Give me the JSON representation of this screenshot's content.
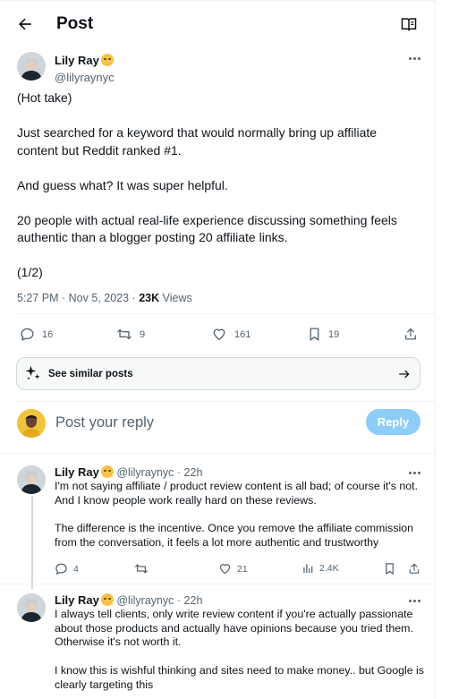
{
  "header": {
    "title": "Post"
  },
  "post": {
    "author_name": "Lily Ray",
    "author_handle": "@lilyraynyc",
    "paragraphs": [
      "(Hot take)",
      "Just searched for a keyword that would normally bring up affiliate content but Reddit ranked #1.",
      "And guess what? It was super helpful.",
      "20 people with actual real-life experience discussing something feels authentic than a blogger posting 20 affiliate links.",
      "(1/2)"
    ],
    "timestamp": "5:27 PM · Nov 5, 2023",
    "views_count": "23K",
    "views_label": "Views",
    "stats": {
      "replies": "16",
      "reposts": "9",
      "likes": "161",
      "bookmarks": "19"
    }
  },
  "similar_posts": {
    "label": "See similar posts"
  },
  "composer": {
    "placeholder": "Post your reply",
    "button_label": "Reply"
  },
  "replies": [
    {
      "author_name": "Lily Ray",
      "author_handle": "@lilyraynyc",
      "time": "· 22h",
      "paragraphs": [
        "I'm not saying affiliate / product review content is all bad; of course it's not. And I know people work really hard on these reviews.",
        "The difference is the incentive. Once you remove the affiliate commission from the conversation, it feels a lot more authentic and trustworthy"
      ],
      "stats": {
        "replies": "4",
        "reposts": "",
        "likes": "21",
        "views": "2.4K"
      }
    },
    {
      "author_name": "Lily Ray",
      "author_handle": "@lilyraynyc",
      "time": "· 22h",
      "paragraphs": [
        "I always tell clients, only write review content if you're actually passionate about those products and actually have opinions because you tried them. Otherwise it's not worth it.",
        "I know this is wishful thinking and sites need to make money.. but Google is clearly targeting this"
      ]
    }
  ],
  "colors": {
    "accent": "#1d9bf0",
    "reply_button_disabled": "#8ecdf8",
    "secondary_text": "#536471",
    "border": "#eff3f4"
  },
  "icons": {
    "back": "arrow-left-icon",
    "reader": "reader-mode-icon",
    "more": "more-dots-icon",
    "reply": "reply-icon",
    "repost": "repost-icon",
    "like": "heart-icon",
    "bookmark": "bookmark-icon",
    "share": "share-icon",
    "views": "views-icon",
    "grok": "sparkle-icon",
    "arrow": "arrow-right-icon"
  }
}
